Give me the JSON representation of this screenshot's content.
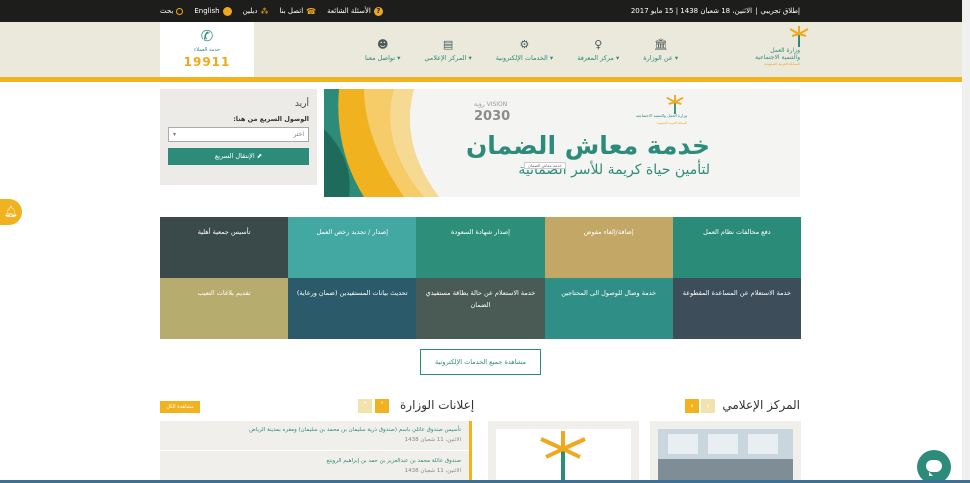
{
  "topbar": {
    "release": "إطلاق تجريبي",
    "date": "الاثنين، 18 شعبان 1438 | 15 مايو 2017",
    "search": "بحث",
    "language": "English",
    "accessibility": "ديلين",
    "contact": "اتصل بنا",
    "faq": "الأسئلة الشائعة"
  },
  "hotline": {
    "label": "خدمة العملاء",
    "number": "19911"
  },
  "nav": [
    {
      "label": "عن الوزارة ▾",
      "icon": "building-icon"
    },
    {
      "label": "مركز المعرفة ▾",
      "icon": "lightbulb-icon"
    },
    {
      "label": "الخدمات الإلكترونية ▾",
      "icon": "gears-icon"
    },
    {
      "label": "المركز الإعلامي ▾",
      "icon": "newspaper-icon"
    },
    {
      "label": "تواصل معنا ▾",
      "icon": "people-icon"
    }
  ],
  "logo": {
    "line1": "وزارة العمل",
    "line2": "والتنمية الاجتماعية",
    "line3": "المملكة العربية السعودية"
  },
  "quick": {
    "title": "أريد",
    "subtitle": "الوصول السريع من هنا:",
    "select_value": "اختر",
    "button": "الإنتقال السريع"
  },
  "banner": {
    "vision_small": "رؤية VISION",
    "vision_year": "2030",
    "headline": "خدمة معاش الضمان",
    "subline": "لتأمين حياة كريمة للأسر الضمانية",
    "badge": "خدمة معاش الضمان",
    "ministry_line1": "وزارة العمل والتنمية الاجتماعية",
    "ministry_line2": "المملكة العربية السعودية"
  },
  "services": [
    {
      "label": "دفع مخالفات نظام العمل",
      "color": "#2a8c78"
    },
    {
      "label": "إضافة/إلغاء مفوض",
      "color": "#c2a766"
    },
    {
      "label": "إصدار شهادة السعودة",
      "color": "#2d8f7a"
    },
    {
      "label": "إصدار / تجديد رخص العمل",
      "color": "#43a8a2"
    },
    {
      "label": "تأسيس جمعية أهلية",
      "color": "#3a4a4a"
    },
    {
      "label": "خدمة الاستعلام عن المساعدة المقطوعة",
      "color": "#3d4d5a"
    },
    {
      "label": "خدمة وصال للوصول الى المحتاجين",
      "color": "#2f8f86"
    },
    {
      "label": "خدمة الاستعلام عن حالة بطاقة مستفيدي الضمان",
      "color": "#4a5a55"
    },
    {
      "label": "تحديث بيانات المستفيدين (ضمان ورعاية)",
      "color": "#2b5a6a"
    },
    {
      "label": "تقديم بلاغات التعيب",
      "color": "#b5ac6e"
    }
  ],
  "view_all": "مشاهدة جميع الخدمات الإلكترونية",
  "media": {
    "title": "المركز الإعلامي"
  },
  "announcements": {
    "title": "إعلانات الوزارة",
    "view_all": "مشاهدة الكل",
    "items": [
      {
        "text": "تأسيس صندوق عائلي باسم (صندوق ذرية سليمان بن محمد بن سليمان) ومقره بمدينة الرياض",
        "date": "الاثنين، 11 شعبان 1438"
      },
      {
        "text": "صندوق عائلة محمد بن عبدالعزيز بن حمد بن إبراهيم الرويتع",
        "date": "الاثنين، 11 شعبان 1438"
      }
    ]
  },
  "colors": {
    "primary": "#2c8c79",
    "accent": "#f0b21e",
    "topbar": "#1d1d1b",
    "header": "#ebe8dc"
  }
}
